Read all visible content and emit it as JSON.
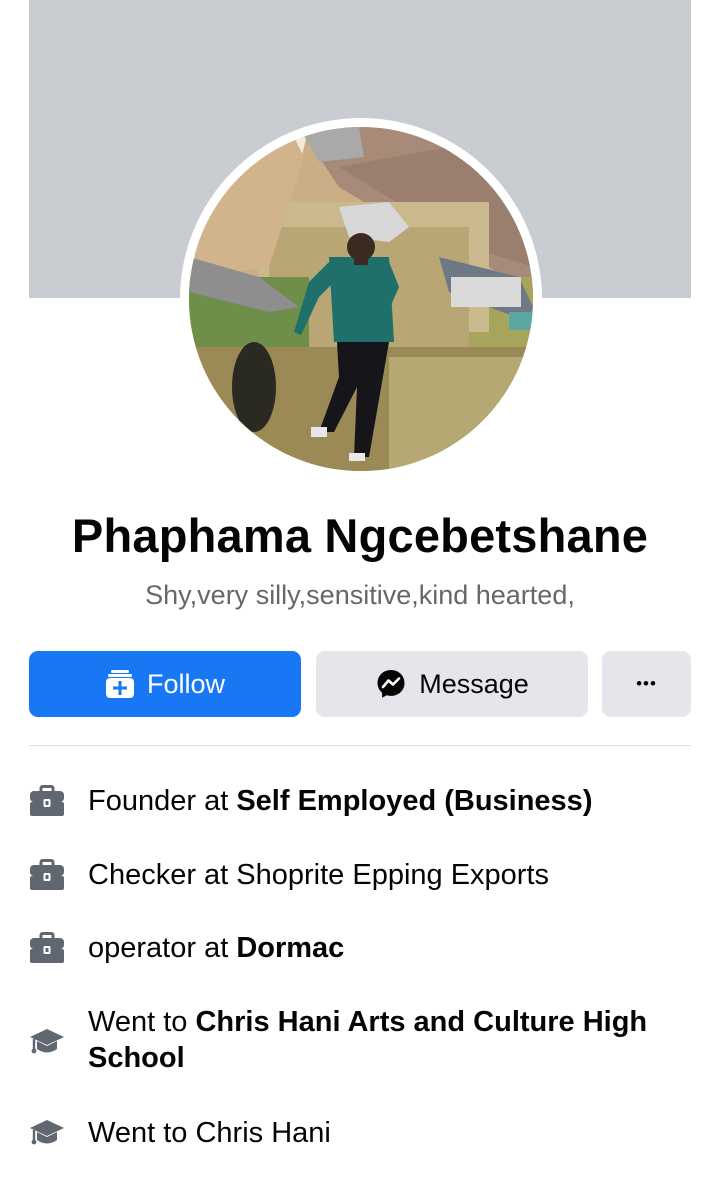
{
  "profile": {
    "name": "Phaphama Ngcebetshane",
    "bio": "Shy,very silly,sensitive,kind hearted,"
  },
  "actions": {
    "follow_label": "Follow",
    "message_label": "Message",
    "more_label": "•••"
  },
  "colors": {
    "accent": "#1877f2",
    "secondary_button": "#e4e6eb",
    "muted_text": "#65676b",
    "cover": "#c9ccd1"
  },
  "details": [
    {
      "icon": "briefcase-icon",
      "prefix": "Founder at ",
      "emphasis": "Self Employed (Business)"
    },
    {
      "icon": "briefcase-icon",
      "prefix": "Checker at Shoprite Epping Exports",
      "emphasis": ""
    },
    {
      "icon": "briefcase-icon",
      "prefix": "operator at ",
      "emphasis": "Dormac"
    },
    {
      "icon": "graduation-cap-icon",
      "prefix": "Went to ",
      "emphasis": "Chris Hani Arts and Culture High School"
    },
    {
      "icon": "graduation-cap-icon",
      "prefix": "Went to Chris Hani",
      "emphasis": ""
    }
  ]
}
